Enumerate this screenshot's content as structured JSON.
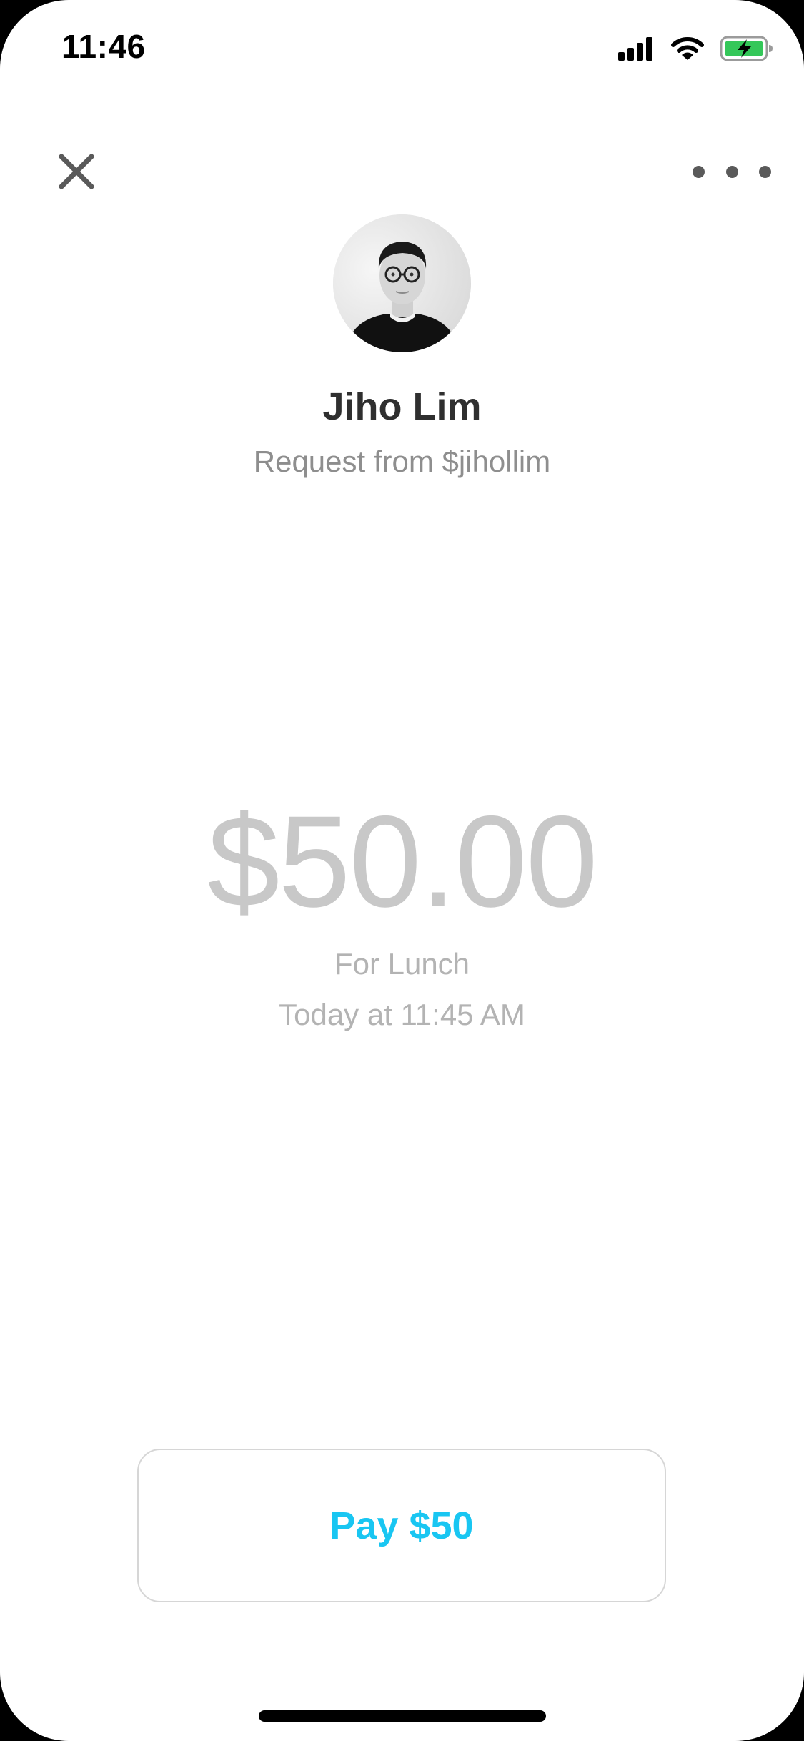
{
  "status_bar": {
    "time": "11:46",
    "icons": [
      "cellular-signal-icon",
      "wifi-icon",
      "battery-charging-icon"
    ],
    "battery_color": "#34c759"
  },
  "toolbar": {
    "close_icon": "close-icon",
    "more_icon": "more-horizontal-icon"
  },
  "profile": {
    "name": "Jiho Lim",
    "subtitle": "Request from $jihollim",
    "avatar": "profile-photo"
  },
  "request": {
    "amount": "$50.00",
    "note": "For Lunch",
    "timestamp": "Today at 11:45 AM"
  },
  "actions": {
    "pay_label": "Pay $50"
  },
  "colors": {
    "accent": "#19c6f2",
    "amount_text": "#c8c8c8",
    "secondary_text": "#8e8e8e"
  }
}
